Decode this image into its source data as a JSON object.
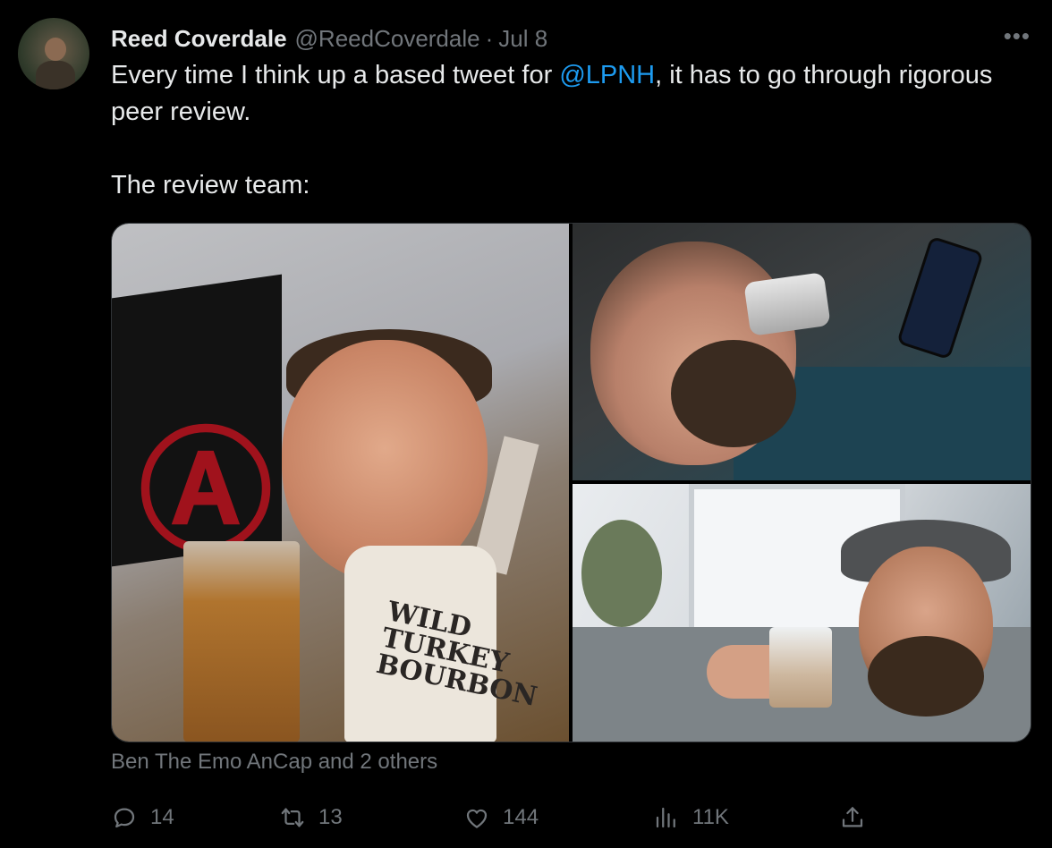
{
  "tweet": {
    "display_name": "Reed Coverdale",
    "handle": "@ReedCoverdale",
    "separator": "·",
    "date": "Jul 8",
    "more_label": "•••",
    "text_before_mention": "Every time I think up a based tweet for ",
    "mention": "@LPNH",
    "text_after_mention": ", it has to go through rigorous peer review.",
    "text_line2": "The review team:",
    "tagged": "Ben The Emo AnCap and 2 others"
  },
  "actions": {
    "reply_count": "14",
    "retweet_count": "13",
    "like_count": "144",
    "views_count": "11K"
  },
  "media": {
    "photo_count": 3,
    "bottle_label": "WILD TURKEY",
    "bottle_sub": "BOURBON"
  },
  "colors": {
    "background": "#000000",
    "primary_text": "#e7e9ea",
    "secondary_text": "#71767b",
    "link": "#1d9bf0",
    "border": "#2f3336"
  },
  "icons": {
    "reply": "reply-icon",
    "retweet": "retweet-icon",
    "like": "heart-icon",
    "views": "views-icon",
    "share": "share-icon",
    "more": "more-icon"
  }
}
